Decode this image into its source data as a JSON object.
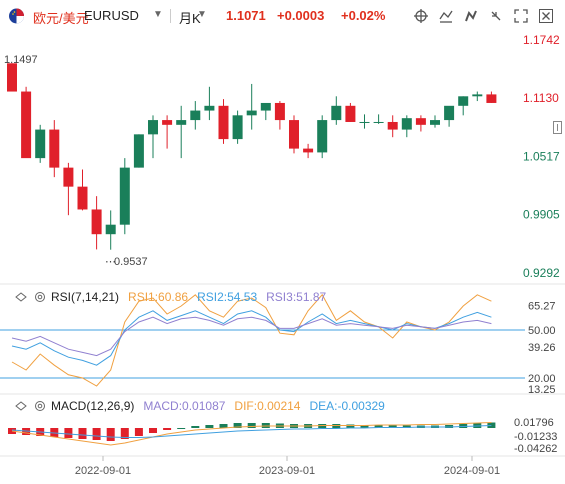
{
  "header": {
    "pair_cn": "欧元/美元",
    "symbol": "EURUSD",
    "period": "月K",
    "price": "1.1071",
    "change": "+0.0003",
    "change_pct": "+0.02%"
  },
  "main_chart": {
    "y_ticks": [
      "1.1742",
      "1.1130",
      "1.0517",
      "0.9905",
      "0.9292"
    ],
    "high_label": "1.1497",
    "low_label": "0.9537"
  },
  "rsi": {
    "label": "RSI(7,14,21)",
    "rsi1": "RSI1:60.86",
    "rsi2": "RSI2:54.53",
    "rsi3": "RSI3:51.87",
    "ticks": [
      "65.27",
      "50.00",
      "39.26",
      "20.00",
      "13.25"
    ]
  },
  "macd": {
    "label": "MACD(12,26,9)",
    "macd": "MACD:0.01087",
    "dif": "DIF:0.00214",
    "dea": "DEA:-0.00329",
    "ticks": [
      "0.01796",
      "-0.01233",
      "-0.04262"
    ]
  },
  "x_axis": [
    "2022-09-01",
    "2023-09-01",
    "2024-09-01"
  ],
  "colors": {
    "up": "#1a7f5a",
    "down": "#e0202a",
    "rsi1": "#f0a040",
    "rsi2": "#40a0e0",
    "rsi3": "#9080d0",
    "ref": "#40a0e0"
  },
  "icons": [
    "flag-eu-us-icon",
    "chevron-down-icon",
    "crosshair-icon",
    "draw-line-icon",
    "drawing-tools-icon",
    "fullscreen-icon",
    "close-icon",
    "collapse-icon",
    "indicator-settings-icon"
  ]
}
